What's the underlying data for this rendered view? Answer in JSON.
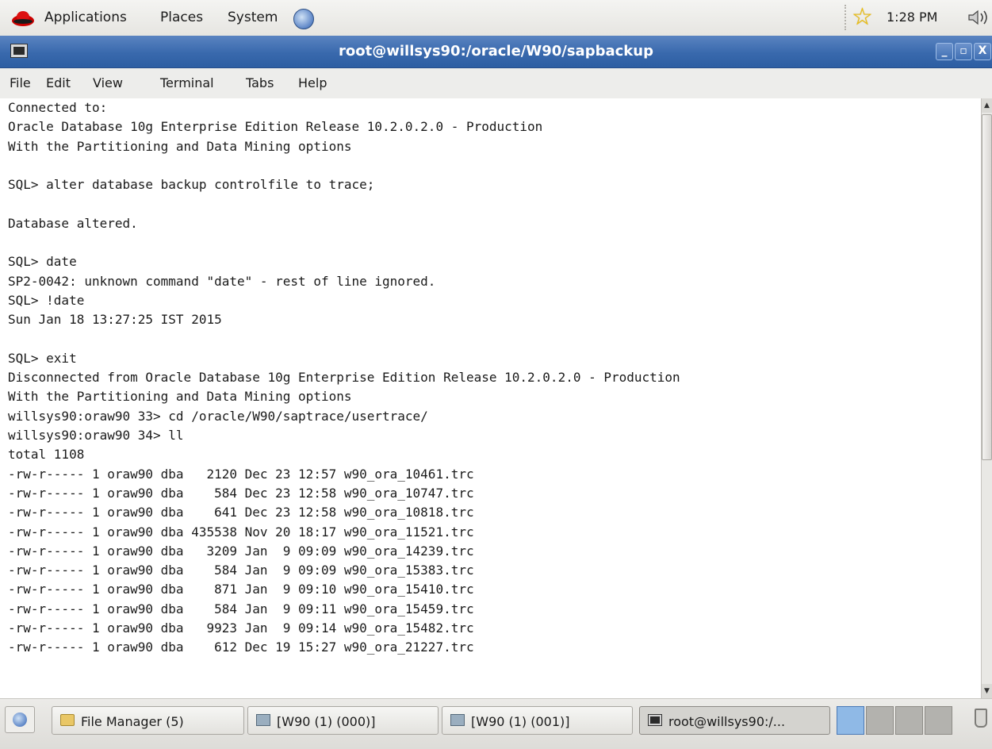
{
  "panel": {
    "applications_label": "Applications",
    "places_label": "Places",
    "system_label": "System",
    "clock": "1:28 PM",
    "icons": [
      "redhat-logo-icon",
      "network-icon",
      "star-icon",
      "volume-icon"
    ]
  },
  "window": {
    "title": "root@willsys90:/oracle/W90/sapbackup",
    "minimize_label": "_",
    "maximize_label": "▫",
    "close_label": "X"
  },
  "menubar": {
    "file": "File",
    "edit": "Edit",
    "view": "View",
    "terminal": "Terminal",
    "tabs": "Tabs",
    "help": "Help"
  },
  "terminal": {
    "lines": [
      "Connected to:",
      "Oracle Database 10g Enterprise Edition Release 10.2.0.2.0 - Production",
      "With the Partitioning and Data Mining options",
      "",
      "SQL> alter database backup controlfile to trace;",
      "",
      "Database altered.",
      "",
      "SQL> date",
      "SP2-0042: unknown command \"date\" - rest of line ignored.",
      "SQL> !date",
      "Sun Jan 18 13:27:25 IST 2015",
      "",
      "SQL> exit",
      "Disconnected from Oracle Database 10g Enterprise Edition Release 10.2.0.2.0 - Production",
      "With the Partitioning and Data Mining options",
      "willsys90:oraw90 33> cd /oracle/W90/saptrace/usertrace/",
      "willsys90:oraw90 34> ll",
      "total 1108",
      "-rw-r----- 1 oraw90 dba   2120 Dec 23 12:57 w90_ora_10461.trc",
      "-rw-r----- 1 oraw90 dba    584 Dec 23 12:58 w90_ora_10747.trc",
      "-rw-r----- 1 oraw90 dba    641 Dec 23 12:58 w90_ora_10818.trc",
      "-rw-r----- 1 oraw90 dba 435538 Nov 20 18:17 w90_ora_11521.trc",
      "-rw-r----- 1 oraw90 dba   3209 Jan  9 09:09 w90_ora_14239.trc",
      "-rw-r----- 1 oraw90 dba    584 Jan  9 09:09 w90_ora_15383.trc",
      "-rw-r----- 1 oraw90 dba    871 Jan  9 09:10 w90_ora_15410.trc",
      "-rw-r----- 1 oraw90 dba    584 Jan  9 09:11 w90_ora_15459.trc",
      "-rw-r----- 1 oraw90 dba   9923 Jan  9 09:14 w90_ora_15482.trc",
      "-rw-r----- 1 oraw90 dba    612 Dec 19 15:27 w90_ora_21227.trc"
    ]
  },
  "taskbar": {
    "tasks": [
      {
        "label": "File Manager (5)",
        "icon": "folder-icon"
      },
      {
        "label": "[W90 (1) (000)]",
        "icon": "window-icon"
      },
      {
        "label": "[W90 (1) (001)]",
        "icon": "window-icon"
      },
      {
        "label": "root@willsys90:/...",
        "icon": "terminal-icon"
      }
    ],
    "workspaces": 4,
    "active_workspace": 1
  }
}
